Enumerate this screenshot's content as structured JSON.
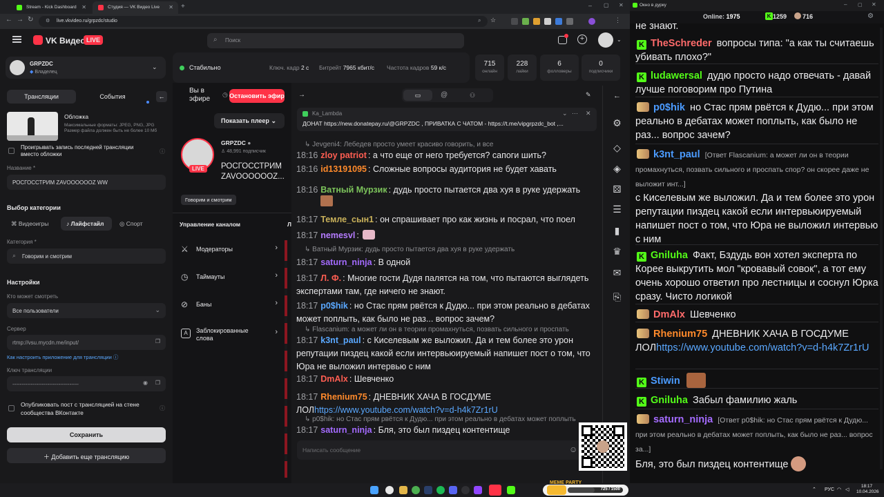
{
  "browser": {
    "tabs": [
      {
        "label": "Stream - Kick Dashboard",
        "favicon_color": "#53fc18"
      },
      {
        "label": "Студия — VK Видео Live",
        "favicon_color": "#ff3347"
      }
    ],
    "url": "live.vkvideo.ru/grpzdc/studio"
  },
  "app": {
    "logo_text": "VK Видео",
    "live_badge": "LIVE",
    "search_placeholder": "Поиск",
    "channel_name": "GRPZDC",
    "channel_role": "Владелец"
  },
  "stats": {
    "status": "Стабильно",
    "keyframe_label": "Ключ. кадр",
    "keyframe_value": "2 с",
    "bitrate_label": "Битрейт",
    "bitrate_value": "7965 кбит/с",
    "fps_label": "Частота кадров",
    "fps_value": "59 к/с",
    "boxes": [
      {
        "value": "715",
        "caption": "онлайн"
      },
      {
        "value": "228",
        "caption": "лайки"
      },
      {
        "value": "6",
        "caption": "фолловеры"
      },
      {
        "value": "0",
        "caption": "подписчики"
      }
    ]
  },
  "left": {
    "tab_streams": "Трансляции",
    "tab_events": "События",
    "cover_title": "Обложка",
    "cover_desc": "Максимальные форматы: JPEG, PNG, JPG Размер файла должен быть не более 10 Мб",
    "play_last": "Проигрывать запись последней трансляции вместо обложки",
    "name_label": "Название *",
    "name_value": "РОСГОССТРИМ ZAVOOOOOOZ WW",
    "category_choice": "Выбор категории",
    "cat_games": "Видеоигры",
    "cat_lifestyle": "Лайфстайл",
    "cat_sport": "Спорт",
    "category_label": "Категория *",
    "category_value": "Говорим и смотрим",
    "settings": "Настройки",
    "who_label": "Кто может смотреть",
    "who_value": "Все пользователи",
    "server_label": "Сервер",
    "server_value": "rtmp://vsu.mycdn.me/input/",
    "how_to": "Как настроить приложение для трансляции",
    "key_label": "Ключ трансляции",
    "key_value": "------------------------------------",
    "publish_post": "Опубликовать пост с трансляцией на стене сообщества ВКонтакте",
    "save": "Сохранить",
    "add_stream": "Добавить еще трансляцию"
  },
  "mid": {
    "on_air": "Вы в эфире",
    "stop_stream": "Остановить эфир",
    "show_player": "Показать плеер",
    "stream_channel": "GRPZDC",
    "subscribers": "48,991 подписчик",
    "stream_title": "РОСГОССТРИМ ZAVOOOOOOZ...",
    "category_tag": "Говорим и смотрим",
    "manage": "Управление каналом",
    "menu": [
      "Модераторы",
      "Таймауты",
      "Баны",
      "Заблокированные слова"
    ]
  },
  "chat": {
    "pinned_user": "Ka_Lambda",
    "pinned_text": "ДОНАТ https://new.donatepay.ru/@GRPZDC , ПРИВАТКА С ЧАТОМ - https://t.me/vipgrpzdc_bot ,...",
    "input_placeholder": "Написать сообщение",
    "messages": [
      {
        "reply": "Jevgeni4: Лебедев просто умеет красиво говорить, и все"
      },
      {
        "time": "18:16",
        "nick": "zloy patriot",
        "color": "#ff5e52",
        "text": "а что еще от него требуется? сапоги шить?"
      },
      {
        "time": "18:16",
        "nick": "id13191095",
        "color": "#ff8a2b",
        "text": "Сложные вопросы аудитория не будет хавать"
      },
      {
        "time": "18:16",
        "nick": "Ватный Мурзик",
        "color": "#7cc35b",
        "text": "дудь просто пытается два хуя в руке удержать"
      },
      {
        "time": "18:17",
        "nick": "Темле_сын1",
        "color": "#c9b15a",
        "text": "он спрашивает про как жизнь и посрал, что поел"
      },
      {
        "time": "18:17",
        "nick": "nemesvl",
        "color": "#b57cff",
        "text": ""
      },
      {
        "reply": "Ватный Мурзик: дудь просто пытается два хуя в руке удержать"
      },
      {
        "time": "18:17",
        "nick": "saturn_ninja",
        "color": "#a46bff",
        "text": "В одной"
      },
      {
        "time": "18:17",
        "nick": "Л. Ф.",
        "color": "#ff5e52",
        "text": "Многие гости Дудя палятся на том, что пытаются выглядеть экспертами там, где ничего не знают."
      },
      {
        "time": "18:17",
        "nick": "p0$hik",
        "color": "#5aa8ff",
        "text": "но Стас прям рвётся к Дудю... при этом реально в дебатах может поплыть, как было не раз... вопрос зачем?"
      },
      {
        "reply": "Flascanium: а может ли он в теории промахнуться, позвать сильного и проспать"
      },
      {
        "time": "18:17",
        "nick": "k3nt_paul",
        "color": "#5aa8ff",
        "text": "с Киселевым же выложил. Да и тем более это урон репутации пиздец какой если интервьюируемый напишет пост о том, что Юра не выложил интервью с ним"
      },
      {
        "time": "18:17",
        "nick": "DmAlx",
        "color": "#ff5e52",
        "text": "Шевченко"
      },
      {
        "time": "18:17",
        "nick": "Rhenium75",
        "color": "#ff8a2b",
        "text": "ДНЕВНИК ХАЧА В ГОСДУМЕ ЛОЛ",
        "link": "https://www.youtube.com/watch?v=d-h4k7Zr1rU"
      },
      {
        "reply": "p0$hik: но Стас прям рвётся к Дудю... при этом реально в дебатах может поплыть"
      },
      {
        "time": "18:17",
        "nick": "saturn_ninja",
        "color": "#a46bff",
        "text": "Бля, это был пиздец контентище"
      }
    ]
  },
  "kick": {
    "window_title": "Окно в дурку",
    "online_label": "Online:",
    "online_value": "1975",
    "count1": "1259",
    "count2": "716",
    "top_cut": "не знают.",
    "messages": [
      {
        "nick": "TheSchreder",
        "color": "#ff6b6b",
        "badge": "k",
        "text": "вопросы типа: \"а как ты считаешь убивать плохо?\""
      },
      {
        "nick": "ludawersal",
        "color": "#53fc18",
        "badge": "k",
        "text": "дудю просто надо отвечать - давай лучше поговорим про Путина"
      },
      {
        "nick": "p0$hik",
        "color": "#4b9bff",
        "badge": "e",
        "text": "но Стас прям рвётся к Дудю... при этом реально в дебатах может поплыть, как было не раз... вопрос зачем?"
      },
      {
        "nick": "k3nt_paul",
        "color": "#4b9bff",
        "badge": "e",
        "reply": "[Ответ Flascanium: а может ли он в теории промахнуться, позвать сильного и проспать спор? он скорее даже не выложит инт...]",
        "text": "с Киселевым же выложил. Да и тем более это урон репутации пиздец какой если интервьюируемый напишет пост о том, что Юра не выложил интервью с ним"
      },
      {
        "nick": "Gniluha",
        "color": "#53fc18",
        "badge": "k",
        "text": "Факт, Бздудь вон хотел эксперта по Корее выкрутить мол \"кровавый совок\", а тот ему очень хорошо ответил про лестницы и соснул Юрка сразу. Чисто логикой"
      },
      {
        "nick": "DmAlx",
        "color": "#ff6b6b",
        "badge": "e",
        "text": "Шевченко"
      },
      {
        "nick": "Rhenium75",
        "color": "#ff8a2b",
        "badge": "e",
        "text": "ДНЕВНИК ХАЧА В ГОСДУМЕ ЛОЛ",
        "link": "https://www.youtube.com/watch?v=d-h4k7Zr1rU"
      },
      {
        "nick": "Stiwin",
        "color": "#4b9bff",
        "badge": "k",
        "text": ""
      },
      {
        "nick": "Gniluha",
        "color": "#53fc18",
        "badge": "k",
        "text": "Забыл фамилию жаль"
      },
      {
        "nick": "saturn_ninja",
        "color": "#a46bff",
        "badge": "e",
        "reply": "[Ответ p0$hik: но Стас прям рвётся к Дудю... при этом реально в дебатах может поплыть, как было не раз... вопрос за...]",
        "text": "Бля, это был пиздец контентище"
      }
    ]
  },
  "taskbar": {
    "lang": "РУС",
    "time": "18:17",
    "date": "10.04.2026",
    "widget_title": "MEME PARTY",
    "widget_value": "725 / 1500"
  },
  "colors": {
    "accent": "#ff3347",
    "kick_green": "#53fc18",
    "link": "#5aa8ff"
  }
}
